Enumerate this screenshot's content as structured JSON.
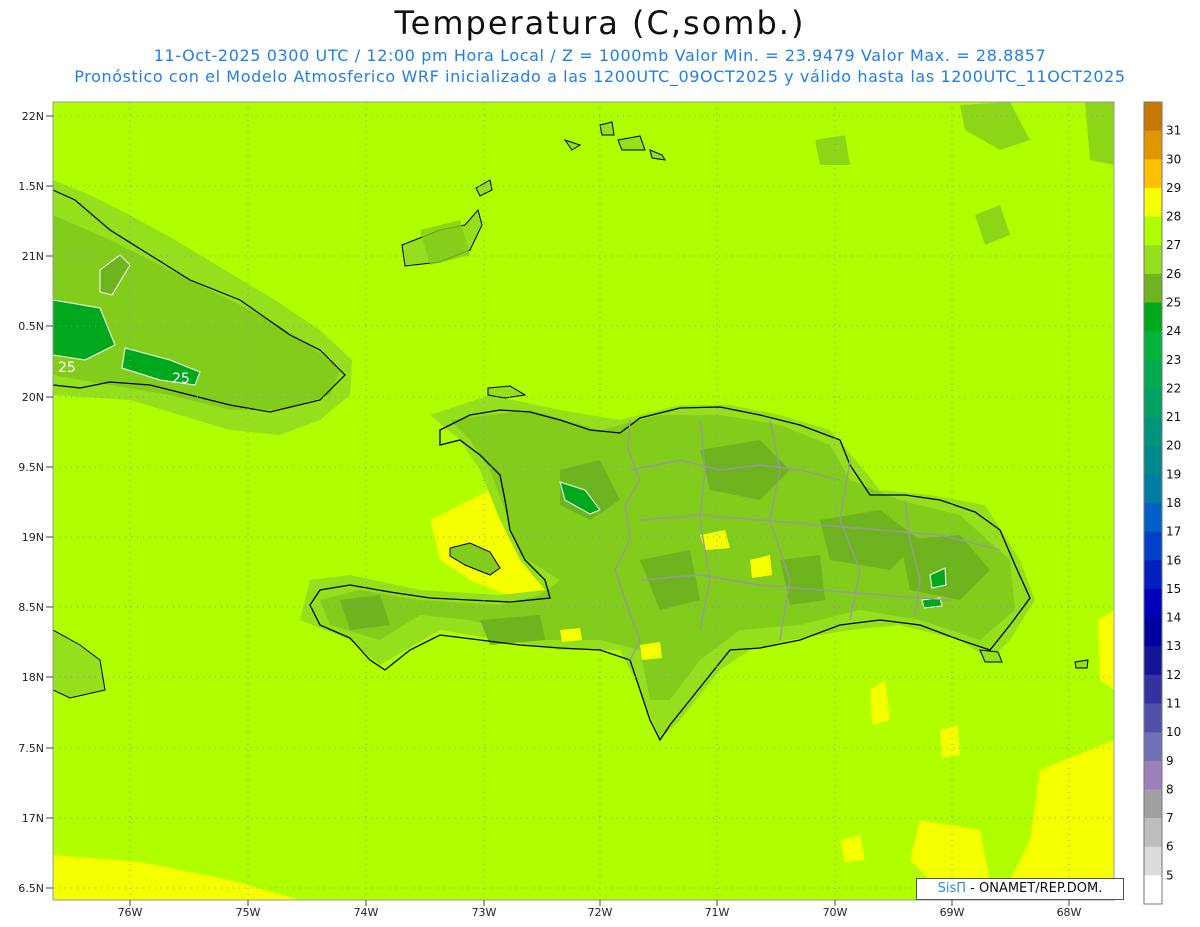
{
  "header": {
    "title": "Temperatura (C,somb.)",
    "subtitle_line1": "11-Oct-2025 0300 UTC / 12:00 pm Hora Local / Z = 1000mb  Valor Min. = 23.9479  Valor Max. = 28.8857",
    "subtitle_line2": "Pronóstico con el Modelo Atmosferico WRF inicializado a las 1200UTC_09OCT2025 y válido hasta las  1200UTC_11OCT2025"
  },
  "map": {
    "lat_labels": [
      "22N",
      "1.5N",
      "21N",
      "0.5N",
      "20N",
      "9.5N",
      "19N",
      "8.5N",
      "18N",
      "7.5N",
      "17N",
      "6.5N"
    ],
    "lon_labels": [
      "76W",
      "75W",
      "74W",
      "73W",
      "72W",
      "71W",
      "70W",
      "69W",
      "68W"
    ],
    "contour_labels": [
      "25",
      "25"
    ],
    "colors": {
      "ocean": "#b0ff00",
      "land_27": "#94e01c",
      "land_26": "#82cc1c",
      "land_25": "#6db41e",
      "patch_24": "#00a81e",
      "warm_28": "#f6ff00",
      "coast": "#000000",
      "border": "#9a9a9a",
      "grid": "#8a8ad8"
    }
  },
  "colorbar": {
    "levels": [
      "31",
      "30",
      "29",
      "28",
      "27",
      "26",
      "25",
      "24",
      "23",
      "22",
      "21",
      "20",
      "19",
      "18",
      "17",
      "16",
      "15",
      "14",
      "13",
      "12",
      "11",
      "10",
      "9",
      "8",
      "7",
      "6",
      "5"
    ],
    "colors": [
      "#c87800",
      "#e19600",
      "#ffc000",
      "#f6ff00",
      "#b0ff00",
      "#94e01c",
      "#6db41e",
      "#00a81e",
      "#00b43c",
      "#00aa50",
      "#00a064",
      "#00947a",
      "#00888e",
      "#007ca0",
      "#0060c8",
      "#0040c8",
      "#0020c0",
      "#0000b8",
      "#0000a0",
      "#141496",
      "#3232a0",
      "#5050aa",
      "#7070b4",
      "#9a82b8",
      "#a0a0a0",
      "#bebebe",
      "#dcdcdc",
      "#ffffff"
    ]
  },
  "credit": {
    "brand": "SisΠ",
    "text": " - ONAMET/REP.DOM."
  }
}
